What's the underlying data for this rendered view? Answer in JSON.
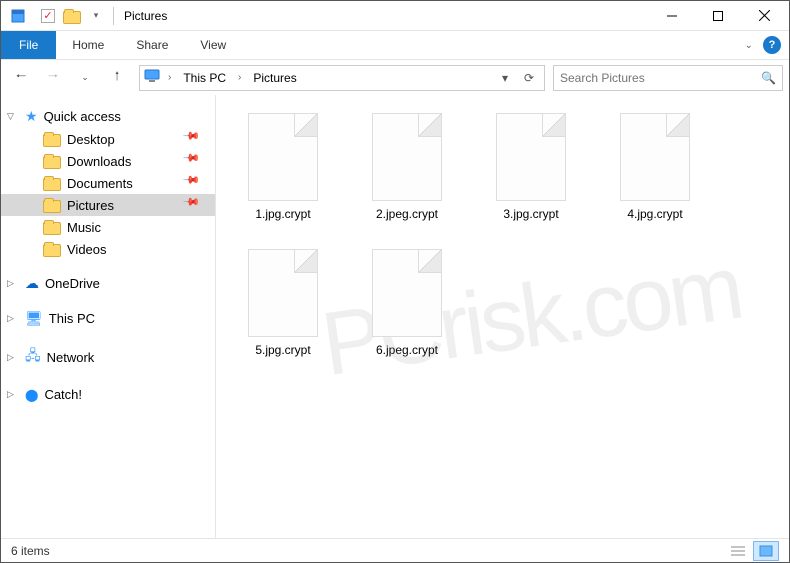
{
  "title": "Pictures",
  "qat": {
    "properties": "Properties",
    "checked": "✓",
    "folder": "Open"
  },
  "wincontrols": {
    "min": "Minimize",
    "max": "Maximize",
    "close": "Close"
  },
  "ribbon": {
    "file": "File",
    "tabs": [
      "Home",
      "Share",
      "View"
    ],
    "expand": "Expand ribbon",
    "help": "?"
  },
  "nav": {
    "back": "Back",
    "forward": "Forward",
    "recent": "Recent",
    "up": "Up"
  },
  "breadcrumb": {
    "root": "This PC",
    "current": "Pictures"
  },
  "address": {
    "dropdown": "▾",
    "refresh": "⟳"
  },
  "search": {
    "placeholder": "Search Pictures",
    "icon": "🔍"
  },
  "sidebar": {
    "quick": {
      "label": "Quick access",
      "items": [
        {
          "label": "Desktop",
          "icon": "desktop",
          "pinned": true
        },
        {
          "label": "Downloads",
          "icon": "downloads",
          "pinned": true
        },
        {
          "label": "Documents",
          "icon": "documents",
          "pinned": true
        },
        {
          "label": "Pictures",
          "icon": "pictures",
          "pinned": true,
          "selected": true
        },
        {
          "label": "Music",
          "icon": "music",
          "pinned": false
        },
        {
          "label": "Videos",
          "icon": "videos",
          "pinned": false
        }
      ]
    },
    "onedrive": "OneDrive",
    "thispc": "This PC",
    "network": "Network",
    "catch": "Catch!"
  },
  "files": [
    {
      "name": "1.jpg.crypt"
    },
    {
      "name": "2.jpeg.crypt"
    },
    {
      "name": "3.jpg.crypt"
    },
    {
      "name": "4.jpg.crypt"
    },
    {
      "name": "5.jpg.crypt"
    },
    {
      "name": "6.jpeg.crypt"
    }
  ],
  "status": {
    "count": "6 items"
  },
  "view": {
    "details": "Details view",
    "large": "Large icons view"
  },
  "watermark": "PCrisk.com"
}
